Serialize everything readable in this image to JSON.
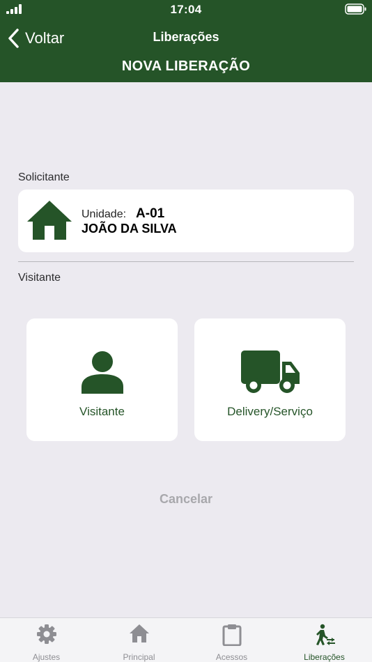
{
  "status_bar": {
    "time": "17:04"
  },
  "nav": {
    "back_label": "Voltar",
    "title": "Liberações"
  },
  "page": {
    "heading": "NOVA LIBERAÇÃO"
  },
  "requester": {
    "section_label": "Solicitante",
    "unit_label": "Unidade:",
    "unit_value": "A-01",
    "name": "JOÃO DA SILVA"
  },
  "visitor": {
    "section_label": "Visitante",
    "options": [
      {
        "label": "Visitante",
        "icon": "person-icon"
      },
      {
        "label": "Delivery/Serviço",
        "icon": "truck-icon"
      }
    ]
  },
  "actions": {
    "cancel_label": "Cancelar"
  },
  "tab_bar": {
    "tabs": [
      {
        "label": "Ajustes",
        "icon": "gear-icon"
      },
      {
        "label": "Principal",
        "icon": "house-icon"
      },
      {
        "label": "Acessos",
        "icon": "clipboard-icon"
      },
      {
        "label": "Liberações",
        "icon": "walking-person-icon"
      }
    ],
    "active_tab": "Liberações"
  },
  "colors": {
    "brand": "#255428",
    "background": "#eceaf0",
    "muted": "#a8a8ac"
  }
}
